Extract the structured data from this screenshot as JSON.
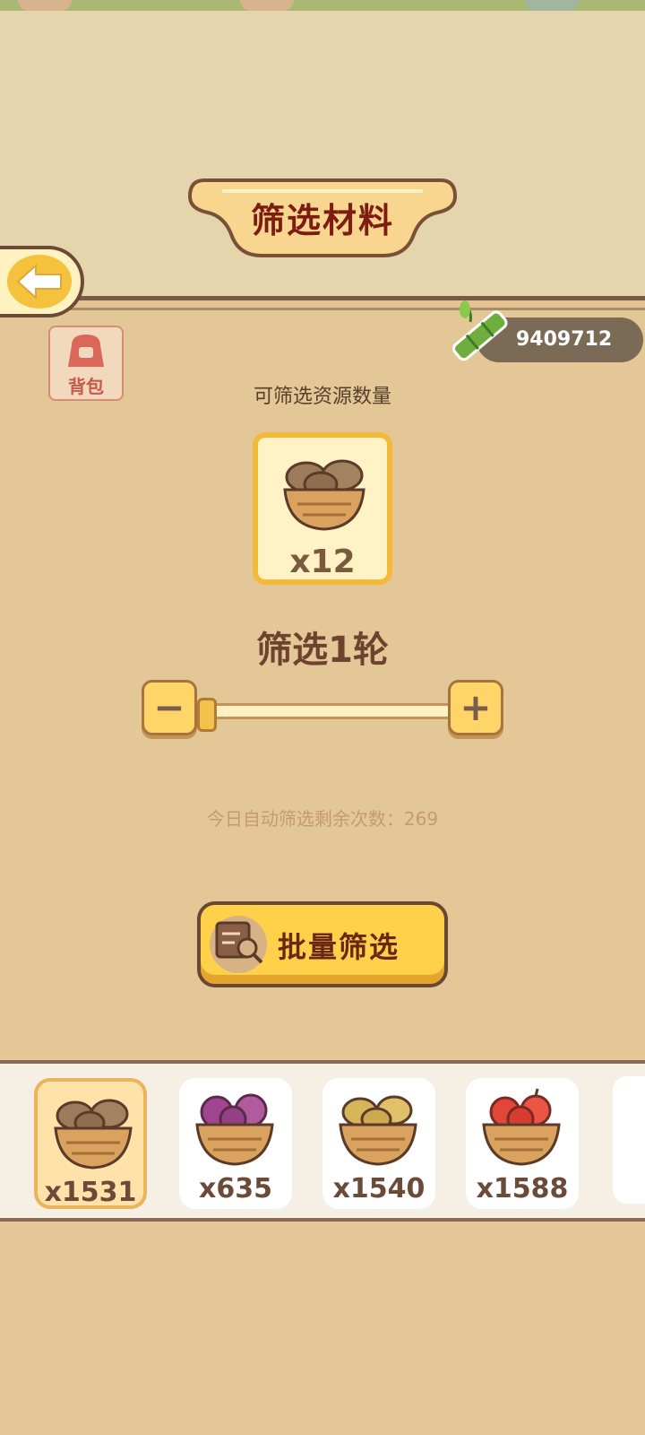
{
  "header": {
    "title": "筛选材料"
  },
  "nav": {
    "back_icon": "arrow-left-icon"
  },
  "bag": {
    "label": "背包",
    "icon": "backpack-icon"
  },
  "currency": {
    "icon": "bamboo-icon",
    "value": "9409712"
  },
  "sift": {
    "available_label": "可筛选资源数量",
    "selected_count": "x12",
    "rounds_label": "筛选1轮",
    "slider": {
      "min_label": "−",
      "max_label": "+",
      "level": 0
    },
    "remaining_label": "今日自动筛选剩余次数：269"
  },
  "batch_button": {
    "label": "批量筛选",
    "icon": "search-document-icon"
  },
  "inventory": [
    {
      "name": "potato-basket",
      "qty": "x1531",
      "selected": true
    },
    {
      "name": "purple-cabbage-basket",
      "qty": "x635",
      "selected": false
    },
    {
      "name": "yellow-potato-basket",
      "qty": "x1540",
      "selected": false
    },
    {
      "name": "apple-basket",
      "qty": "x1588",
      "selected": false
    }
  ],
  "colors": {
    "accent": "#f3b93a",
    "title_red": "#7d1c10",
    "panel": "#e4c796"
  }
}
